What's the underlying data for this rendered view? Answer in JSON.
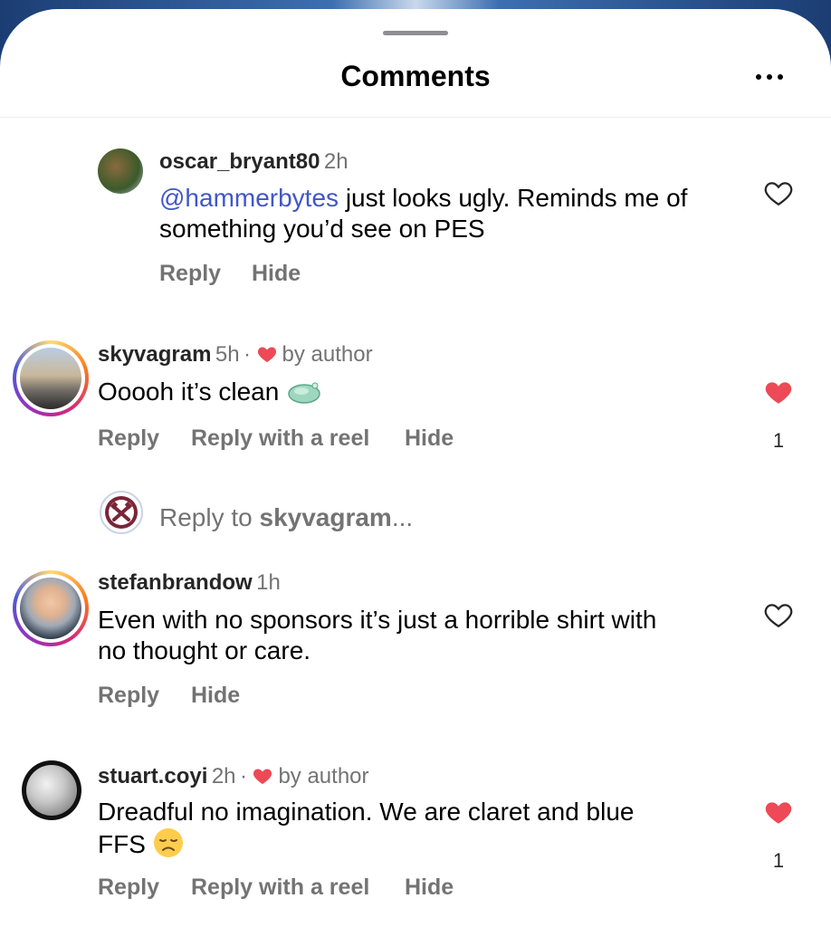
{
  "header": {
    "title": "Comments",
    "more_icon": "more-horizontal-icon"
  },
  "comments": [
    {
      "username": "oscar_bryant80",
      "time": "2h",
      "mention": "@hammerbytes",
      "text_line1": " just looks ugly. Reminds me of",
      "text_line2": "something you’d see on PES",
      "liked": false,
      "actions": [
        "Reply",
        "Hide"
      ]
    },
    {
      "username": "skyvagram",
      "time": "5h",
      "author_badge": "by author",
      "text": "Ooooh it’s clean",
      "emoji_icon": "green-soap-emoji",
      "liked": true,
      "like_count": "1",
      "actions": [
        "Reply",
        "Reply with a reel",
        "Hide"
      ]
    },
    {
      "username": "stefanbrandow",
      "time": "1h",
      "text_line1": "Even with no sponsors it’s just a horrible shirt with",
      "text_line2": "no thought or care.",
      "liked": false,
      "actions": [
        "Reply",
        "Hide"
      ]
    },
    {
      "username": "stuart.coyi",
      "time": "2h",
      "author_badge": "by author",
      "text_line1": "Dreadful no imagination. We are claret and blue",
      "text_line2": "FFS",
      "emoji_icon": "disappointed-face-emoji",
      "liked": true,
      "like_count": "1",
      "actions": [
        "Reply",
        "Reply with a reel",
        "Hide"
      ]
    }
  ],
  "reply_input": {
    "prefix": "Reply to ",
    "username": "skyvagram",
    "suffix": "..."
  },
  "colors": {
    "like_red": "#ed4956",
    "mention_blue": "#4156c9",
    "muted_gray": "#737373"
  },
  "separator": "·"
}
